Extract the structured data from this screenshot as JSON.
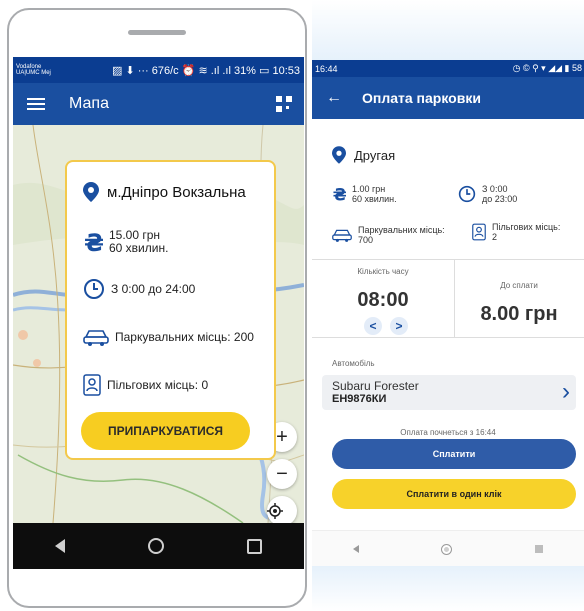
{
  "left_phone": {
    "status": {
      "carrier": "Vodafone UA|UMC Mej",
      "indicators": "▨ ⬇ ··· 676/c ⏰ ≋ .ıl .ıl 31% ▭ 10:53"
    },
    "appbar": {
      "title": "Мапа",
      "menu_icon": "hamburger-icon",
      "qr_icon": "qr-code-icon"
    },
    "card": {
      "station": "м.Дніпро Вокзальна",
      "price": "15.00 грн",
      "duration": "60 хвилин.",
      "hours": "З 0:00 до 24:00",
      "parking_spots": "Паркувальних місць: 200",
      "preferential_spots": "Пільгових місць: 0",
      "park_button": "ПРИПАРКУВАТИСЯ"
    },
    "map_controls": {
      "zoom_in": "+",
      "zoom_out": "−",
      "locate_icon": "crosshair-icon"
    },
    "colors": {
      "accent": "#1a4fa0",
      "button": "#f7cd21",
      "card_border": "#f3c94b"
    }
  },
  "right_phone": {
    "status": {
      "time": "16:44",
      "indicators": "◷ © ⚲ ▾ ◢◢ ▮ 58"
    },
    "appbar": {
      "title": "Оплата парковки",
      "back_icon": "back-arrow-icon"
    },
    "place": {
      "name": "Другая"
    },
    "info": {
      "price": "1.00 грн",
      "duration": "60 хвилин.",
      "from": "З 0:00",
      "to": "до 23:00",
      "parking_label": "Паркувальних місць:",
      "parking_value": "700",
      "preferential_label": "Пільгових місць:",
      "preferential_value": "2"
    },
    "time_block": {
      "label": "Кількість часу",
      "value": "08:00",
      "prev": "<",
      "next": ">"
    },
    "payment": {
      "label": "До сплати",
      "value": "8.00 грн"
    },
    "car": {
      "label": "Автомобіль",
      "model": "Subaru Forester",
      "plate": "ЕН9876КИ"
    },
    "pay_start": "Оплата почнеться з 16:44",
    "pay_button": "Сплатити",
    "pay_one_click_button": "Сплатити в один клік",
    "colors": {
      "pay": "#2f5ca8",
      "pay_one_click": "#f7d22a"
    }
  }
}
